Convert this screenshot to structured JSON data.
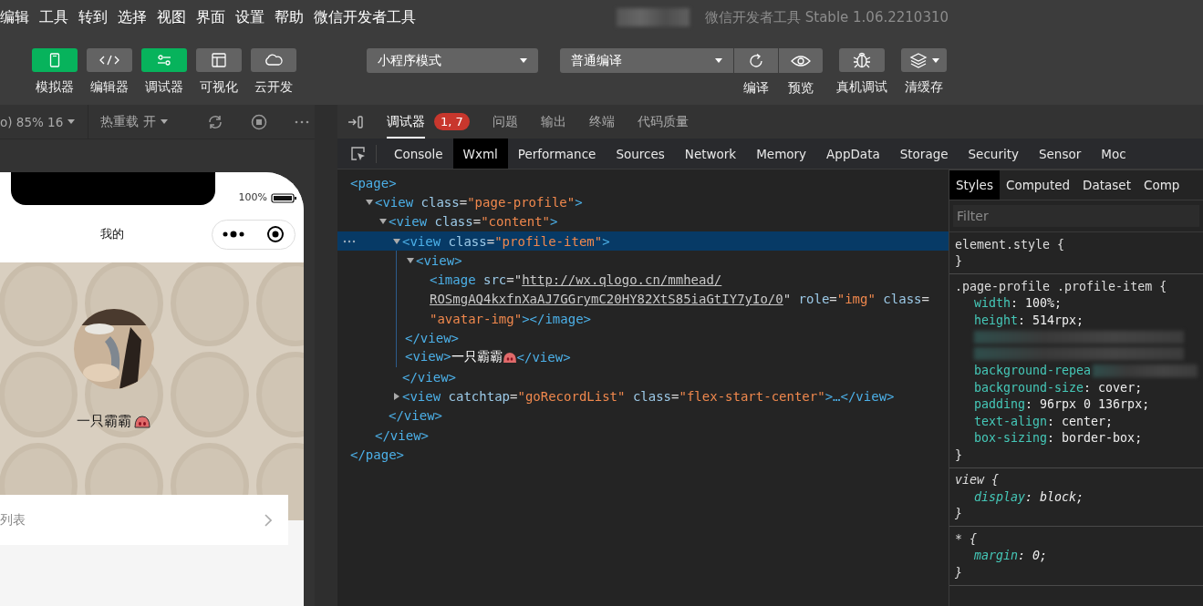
{
  "menu": [
    "编辑",
    "工具",
    "转到",
    "选择",
    "视图",
    "界面",
    "设置",
    "帮助",
    "微信开发者工具"
  ],
  "window": {
    "title": "微信开发者工具 Stable 1.06.2210310"
  },
  "toolbar": {
    "views": [
      {
        "label": "模拟器",
        "on": true
      },
      {
        "label": "编辑器",
        "on": false
      },
      {
        "label": "调试器",
        "on": true
      },
      {
        "label": "可视化",
        "on": false
      },
      {
        "label": "云开发",
        "on": false
      }
    ],
    "mode_select": {
      "value": "小程序模式"
    },
    "compile_select": {
      "value": "普通编译"
    },
    "actions": [
      {
        "label": "编译",
        "kind": "joined"
      },
      {
        "label": "预览",
        "kind": "joined"
      },
      {
        "label": "真机调试",
        "kind": "single"
      },
      {
        "label": "清缓存",
        "kind": "single"
      }
    ]
  },
  "simulator": {
    "zoom": "o) 85% 16",
    "hot_reload": "热重载 开",
    "battery": "100%",
    "nav_title": "我的",
    "profile_name": "一只霸霸",
    "list_item": "列表"
  },
  "devtools": {
    "panel_tabs": [
      {
        "label": "调试器",
        "selected": true,
        "badge": "1, 7"
      },
      {
        "label": "问题",
        "selected": false
      },
      {
        "label": "输出",
        "selected": false
      },
      {
        "label": "终端",
        "selected": false
      },
      {
        "label": "代码质量",
        "selected": false
      }
    ],
    "tool_tabs": [
      {
        "label": "Console",
        "selected": false
      },
      {
        "label": "Wxml",
        "selected": true
      },
      {
        "label": "Performance",
        "selected": false
      },
      {
        "label": "Sources",
        "selected": false
      },
      {
        "label": "Network",
        "selected": false
      },
      {
        "label": "Memory",
        "selected": false
      },
      {
        "label": "AppData",
        "selected": false
      },
      {
        "label": "Storage",
        "selected": false
      },
      {
        "label": "Security",
        "selected": false
      },
      {
        "label": "Sensor",
        "selected": false
      },
      {
        "label": "Moc",
        "selected": false
      }
    ],
    "wxml": {
      "lines": [
        [
          {
            "t": "<page>",
            "kind": "tag"
          }
        ]
      ],
      "selected": false,
      "close": [
        {
          "t": "</page>",
          "kind": "tag"
        }
      ],
      "children": [
        {
          "lines": [
            [
              {
                "t": "<view",
                "kind": "tag"
              },
              {
                "t": " class",
                "kind": "attr"
              },
              {
                "t": "=",
                "kind": "eq"
              },
              {
                "t": "\"page-profile\"",
                "kind": "val"
              },
              {
                "t": ">",
                "kind": "tag"
              }
            ]
          ],
          "expanded": true,
          "selected": false,
          "close": [
            {
              "t": "</view>",
              "kind": "tag"
            }
          ],
          "children": [
            {
              "lines": [
                [
                  {
                    "t": "<view",
                    "kind": "tag"
                  },
                  {
                    "t": " class",
                    "kind": "attr"
                  },
                  {
                    "t": "=",
                    "kind": "eq"
                  },
                  {
                    "t": "\"content\"",
                    "kind": "val"
                  },
                  {
                    "t": ">",
                    "kind": "tag"
                  }
                ]
              ],
              "expanded": true,
              "selected": false,
              "close": [
                {
                  "t": "</view>",
                  "kind": "tag"
                }
              ],
              "children": [
                {
                  "lines": [
                    [
                      {
                        "t": "<view",
                        "kind": "tag"
                      },
                      {
                        "t": " class",
                        "kind": "attr"
                      },
                      {
                        "t": "=",
                        "kind": "eq"
                      },
                      {
                        "t": "\"profile-item\"",
                        "kind": "val"
                      },
                      {
                        "t": ">",
                        "kind": "tag"
                      }
                    ]
                  ],
                  "expanded": true,
                  "selected": true,
                  "close": [
                    {
                      "t": "</view>",
                      "kind": "tag"
                    }
                  ],
                  "children": [
                    {
                      "lines": [
                        [
                          {
                            "t": "<view>",
                            "kind": "tag"
                          }
                        ]
                      ],
                      "expanded": true,
                      "selected": false,
                      "close": [
                        {
                          "t": "</view>",
                          "kind": "tag"
                        }
                      ],
                      "children": [
                        {
                          "lines": [
                            [
                              {
                                "t": "<image",
                                "kind": "tag"
                              },
                              {
                                "t": " src",
                                "kind": "attr"
                              },
                              {
                                "t": "=\"",
                                "kind": "eq"
                              },
                              {
                                "t": "http://wx.qlogo.cn/mmhead/",
                                "kind": "link"
                              }
                            ],
                            [
                              {
                                "t": "ROSmgAQ4kxfnXaAJ7GGrymC20HY82XtS85iaGtIY7yIo/0",
                                "kind": "link"
                              },
                              {
                                "t": "\"",
                                "kind": "eq"
                              },
                              {
                                "t": " role",
                                "kind": "attr"
                              },
                              {
                                "t": "=",
                                "kind": "eq"
                              },
                              {
                                "t": "\"img\"",
                                "kind": "val"
                              },
                              {
                                "t": " class",
                                "kind": "attr"
                              },
                              {
                                "t": "=",
                                "kind": "eq"
                              }
                            ],
                            [
                              {
                                "t": "\"avatar-img\"",
                                "kind": "val"
                              },
                              {
                                "t": "></image>",
                                "kind": "tag"
                              }
                            ]
                          ],
                          "selected": false
                        }
                      ]
                    },
                    {
                      "lines": [
                        [
                          {
                            "t": "<view>",
                            "kind": "tag"
                          },
                          {
                            "t": "一只霸霸",
                            "kind": "text"
                          },
                          {
                            "kind": "icon"
                          },
                          {
                            "t": "</view>",
                            "kind": "tag"
                          }
                        ]
                      ],
                      "selected": false
                    }
                  ]
                },
                {
                  "lines": [
                    [
                      {
                        "t": "<view",
                        "kind": "tag"
                      },
                      {
                        "t": " catchtap",
                        "kind": "attr"
                      },
                      {
                        "t": "=",
                        "kind": "eq"
                      },
                      {
                        "t": "\"goRecordList\"",
                        "kind": "val"
                      },
                      {
                        "t": " class",
                        "kind": "attr"
                      },
                      {
                        "t": "=",
                        "kind": "eq"
                      },
                      {
                        "t": "\"flex-start-center\"",
                        "kind": "val"
                      },
                      {
                        "t": ">…</view>",
                        "kind": "tag"
                      }
                    ]
                  ],
                  "expanded": false,
                  "selected": false
                }
              ]
            }
          ]
        }
      ]
    },
    "style_tabs": [
      {
        "label": "Styles",
        "selected": true
      },
      {
        "label": "Computed",
        "selected": false
      },
      {
        "label": "Dataset",
        "selected": false
      },
      {
        "label": "Comp",
        "selected": false
      }
    ],
    "filter": {
      "placeholder": "Filter"
    },
    "rules": [
      {
        "selector": "element.style {",
        "close": "}",
        "user_agent": false
      },
      {
        "selector": ".page-profile .profile-item {",
        "close": "}",
        "user_agent": false,
        "props": [
          {
            "kind": "plain",
            "name": "width",
            "value": ": 100%;"
          },
          {
            "kind": "plain",
            "name": "height",
            "value": ": 514rpx;"
          },
          {
            "kind": "redacted"
          },
          {
            "kind": "redacted"
          },
          {
            "kind": "partial",
            "name": "background-repea"
          },
          {
            "kind": "plain",
            "name": "background-size",
            "value": ": cover;"
          },
          {
            "kind": "plain",
            "name": "padding",
            "value": ": 96rpx 0 136rpx;"
          },
          {
            "kind": "plain",
            "name": "text-align",
            "value": ": center;"
          },
          {
            "kind": "plain",
            "name": "box-sizing",
            "value": ": border-box;"
          }
        ]
      },
      {
        "selector": "view {",
        "close": "}",
        "user_agent": true,
        "props": [
          {
            "kind": "plain",
            "name": "display",
            "value": ": block;"
          }
        ]
      },
      {
        "selector": "* {",
        "close": "}",
        "user_agent": true,
        "props": [
          {
            "kind": "plain",
            "name": "margin",
            "value": ": 0;"
          }
        ]
      }
    ]
  }
}
